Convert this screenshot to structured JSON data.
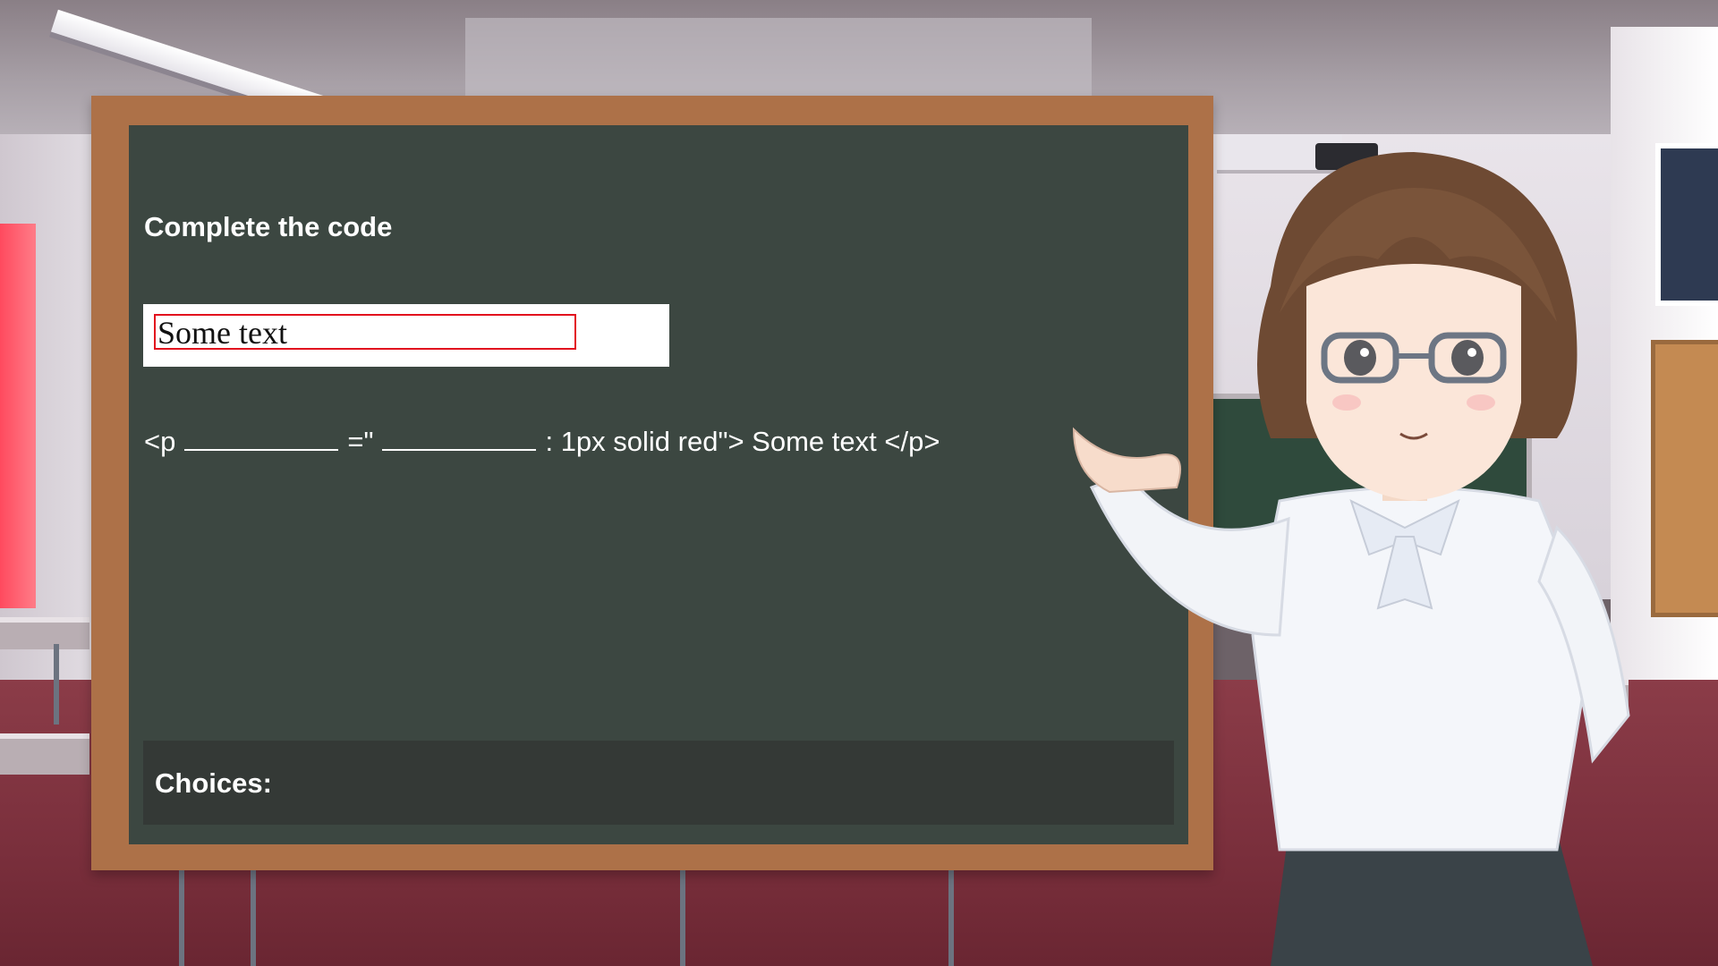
{
  "board": {
    "prompt": "Complete the code",
    "preview_text": "Some text",
    "code": {
      "before": "<p",
      "middle": "=\"",
      "after": ": 1px solid red\"> Some text </p>"
    },
    "choices_label": "Choices:"
  },
  "colors": {
    "board": "#3c4741",
    "frame": "#ad7148",
    "choices_bar": "#343936",
    "preview_border": "#e2101e"
  },
  "icons": [
    "teacher-character"
  ]
}
